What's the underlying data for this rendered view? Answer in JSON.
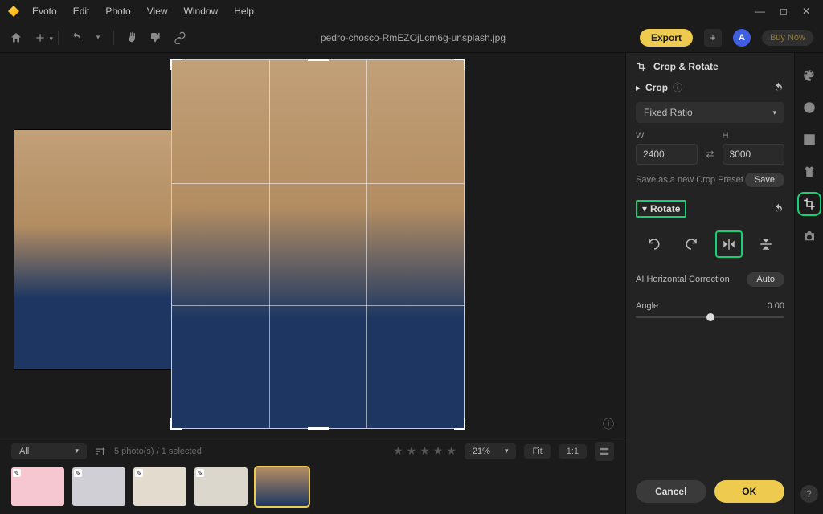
{
  "app_name": "Evoto",
  "menu": [
    "Edit",
    "Photo",
    "View",
    "Window",
    "Help"
  ],
  "window_controls": [
    "min",
    "max",
    "close"
  ],
  "toolbar": {
    "export_label": "Export",
    "avatar_letter": "A",
    "buy_label": "Buy Now"
  },
  "file_title": "pedro-chosco-RmEZOjLcm6g-unsplash.jpg",
  "filmstrip": {
    "filter_label": "All",
    "count_label": "5 photo(s) / 1 selected",
    "zoom_label": "21%",
    "fit_label": "Fit",
    "ratio_label": "1:1"
  },
  "panel": {
    "title": "Crop & Rotate",
    "crop_label": "Crop",
    "ratio_select": "Fixed Ratio",
    "w_label": "W",
    "h_label": "H",
    "w_value": "2400",
    "h_value": "3000",
    "save_preset_label": "Save as a new Crop Preset",
    "save_btn": "Save",
    "rotate_label": "Rotate",
    "ai_label": "AI Horizontal Correction",
    "auto_btn": "Auto",
    "angle_label": "Angle",
    "angle_value": "0.00",
    "cancel_btn": "Cancel",
    "ok_btn": "OK"
  }
}
